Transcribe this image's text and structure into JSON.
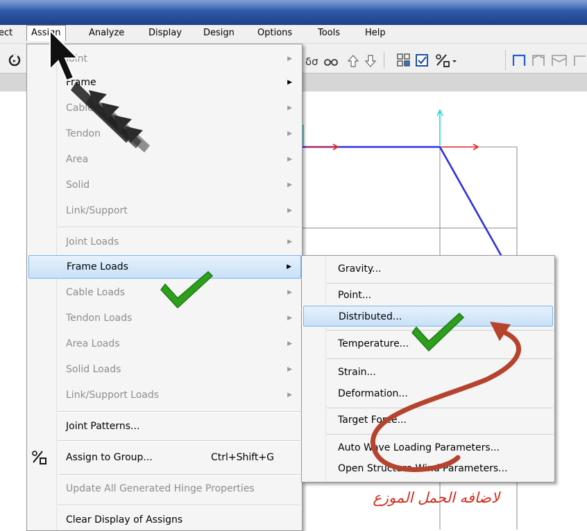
{
  "menubar": {
    "items": [
      "ect",
      "Assign",
      "Analyze",
      "Display",
      "Design",
      "Options",
      "Tools",
      "Help"
    ]
  },
  "assign_menu": {
    "items": [
      {
        "label": "Joint",
        "state": "disabled",
        "submenu": true
      },
      {
        "label": "Frame",
        "state": "enabled",
        "submenu": true
      },
      {
        "label": "Cable",
        "state": "disabled",
        "submenu": true
      },
      {
        "label": "Tendon",
        "state": "disabled",
        "submenu": true
      },
      {
        "label": "Area",
        "state": "disabled",
        "submenu": true
      },
      {
        "label": "Solid",
        "state": "disabled",
        "submenu": true
      },
      {
        "label": "Link/Support",
        "state": "disabled",
        "submenu": true
      },
      {
        "label": "Joint Loads",
        "state": "disabled",
        "submenu": true
      },
      {
        "label": "Frame Loads",
        "state": "highlighted",
        "submenu": true
      },
      {
        "label": "Cable Loads",
        "state": "disabled",
        "submenu": true
      },
      {
        "label": "Tendon Loads",
        "state": "disabled",
        "submenu": true
      },
      {
        "label": "Area Loads",
        "state": "disabled",
        "submenu": true
      },
      {
        "label": "Solid Loads",
        "state": "disabled",
        "submenu": true
      },
      {
        "label": "Link/Support Loads",
        "state": "disabled",
        "submenu": true
      },
      {
        "label": "Joint Patterns...",
        "state": "enabled",
        "submenu": false
      },
      {
        "label": "Assign to Group...",
        "state": "enabled",
        "submenu": false,
        "shortcut": "Ctrl+Shift+G"
      },
      {
        "label": "Update All Generated Hinge Properties",
        "state": "disabled",
        "submenu": false
      },
      {
        "label": "Clear Display of Assigns",
        "state": "enabled",
        "submenu": false
      }
    ]
  },
  "frame_loads_submenu": {
    "items": [
      {
        "label": "Gravity...",
        "state": "enabled"
      },
      {
        "label": "Point...",
        "state": "enabled"
      },
      {
        "label": "Distributed...",
        "state": "highlighted"
      },
      {
        "label": "Temperature...",
        "state": "enabled"
      },
      {
        "label": "Strain...",
        "state": "enabled"
      },
      {
        "label": "Deformation...",
        "state": "enabled"
      },
      {
        "label": "Target Force...",
        "state": "enabled"
      },
      {
        "label": "Auto Wave Loading Parameters...",
        "state": "enabled"
      },
      {
        "label": "Open Structure Wind Parameters...",
        "state": "enabled"
      }
    ]
  },
  "annotation": {
    "text": "لاضافه الحمل الموزع",
    "color": "#d42a1c"
  },
  "colors": {
    "accent_highlight": "#c8e1f8",
    "checkmark": "#2e9e1e",
    "frame_line": "#2d2de8",
    "arrow_red": "#e82020",
    "arrow_cyan": "#22d6e0",
    "curve_arrow": "#b5432e"
  },
  "icons": [
    "back-icon",
    "rotate-icon",
    "glasses-icon",
    "up-arrow-icon",
    "down-arrow-icon",
    "grid-icon",
    "check-box-icon",
    "assign-group-icon",
    "frame-icon"
  ]
}
